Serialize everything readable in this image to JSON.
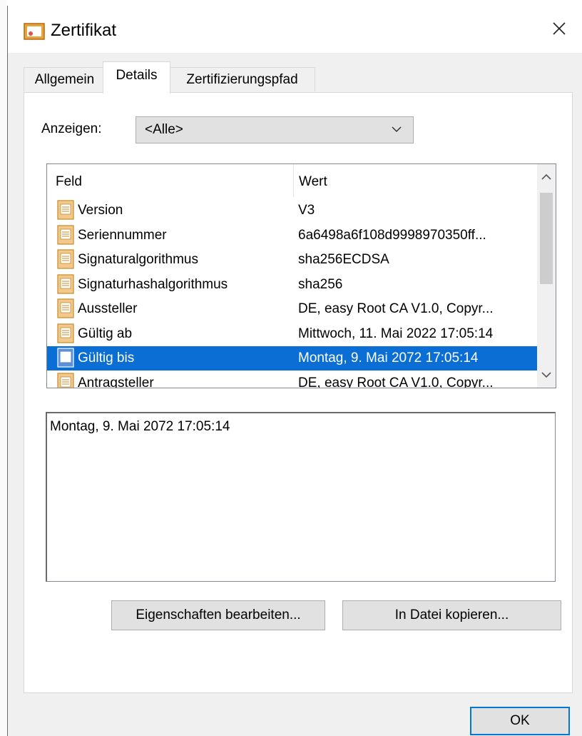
{
  "window": {
    "title": "Zertifikat"
  },
  "tabs": [
    {
      "label": "Allgemein"
    },
    {
      "label": "Details"
    },
    {
      "label": "Zertifizierungspfad"
    }
  ],
  "show": {
    "label": "Anzeigen:",
    "value": "<Alle>"
  },
  "list": {
    "headers": {
      "field": "Feld",
      "value": "Wert"
    },
    "rows": [
      {
        "field": "Version",
        "value": "V3"
      },
      {
        "field": "Seriennummer",
        "value": "6a6498a6f108d9998970350ff..."
      },
      {
        "field": "Signaturalgorithmus",
        "value": "sha256ECDSA"
      },
      {
        "field": "Signaturhashalgorithmus",
        "value": "sha256"
      },
      {
        "field": "Aussteller",
        "value": "DE, easy Root CA V1.0, Copyr..."
      },
      {
        "field": "Gültig ab",
        "value": "Mittwoch, 11. Mai 2022 17:05:14"
      },
      {
        "field": "Gültig bis",
        "value": "Montag, 9. Mai 2072 17:05:14"
      },
      {
        "field": "Antragsteller",
        "value": "DE, easy Root CA V1.0, Copyr..."
      }
    ],
    "selected_index": 6
  },
  "detail": {
    "text": "Montag, 9. Mai 2072 17:05:14"
  },
  "buttons": {
    "edit_properties": "Eigenschaften bearbeiten...",
    "copy_to_file": "In Datei kopieren...",
    "ok": "OK"
  },
  "colors": {
    "selection": "#0a6ed4",
    "focus_border": "#0078d7"
  }
}
